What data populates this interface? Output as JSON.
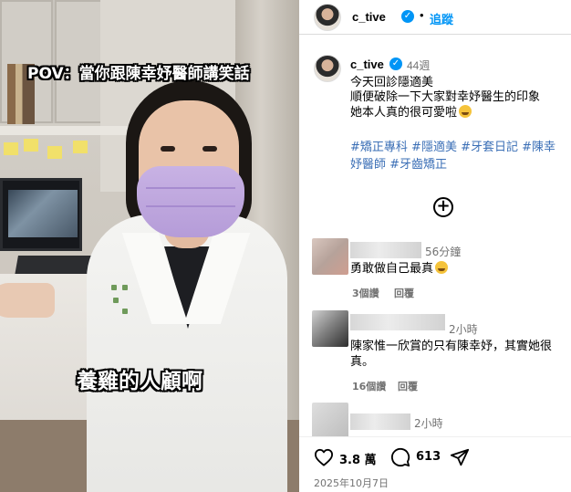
{
  "photo": {
    "caption_top": "POV：當你跟陳幸妤醫師講笑話",
    "caption_middle": "養雞的人顧啊"
  },
  "header": {
    "username": "c_tive",
    "separator": "•",
    "follow_label": "追蹤"
  },
  "post": {
    "username": "c_tive",
    "time_ago": "44週",
    "caption_lines": [
      "今天回診隱適美",
      "順便破除一下大家對幸妤醫生的印象",
      "她本人真的很可愛啦"
    ],
    "hashtags": [
      "#矯正專科",
      "#隱適美",
      "#牙套日記",
      "#陳幸妤醫師",
      "#牙齒矯正"
    ]
  },
  "comments": [
    {
      "time": "56分鐘",
      "text": "勇敢做自己最真",
      "likes_label": "3個讚",
      "reply_label": "回覆"
    },
    {
      "time": "2小時",
      "text": "陳家惟一欣賞的只有陳幸妤，其實她很真。",
      "likes_label": "16個讚",
      "reply_label": "回覆"
    },
    {
      "time": "2小時"
    }
  ],
  "actions": {
    "likes_count": "3.8 萬",
    "comments_count": "613",
    "date": "2025年10月7日"
  },
  "icons": {
    "heart": "heart-icon",
    "comment": "comment-icon",
    "share": "share-icon",
    "verified": "verified-badge-icon",
    "load_more": "plus-circle-icon"
  },
  "colors": {
    "accent": "#0095f6",
    "hashtag": "#00376b",
    "muted": "#737373"
  }
}
